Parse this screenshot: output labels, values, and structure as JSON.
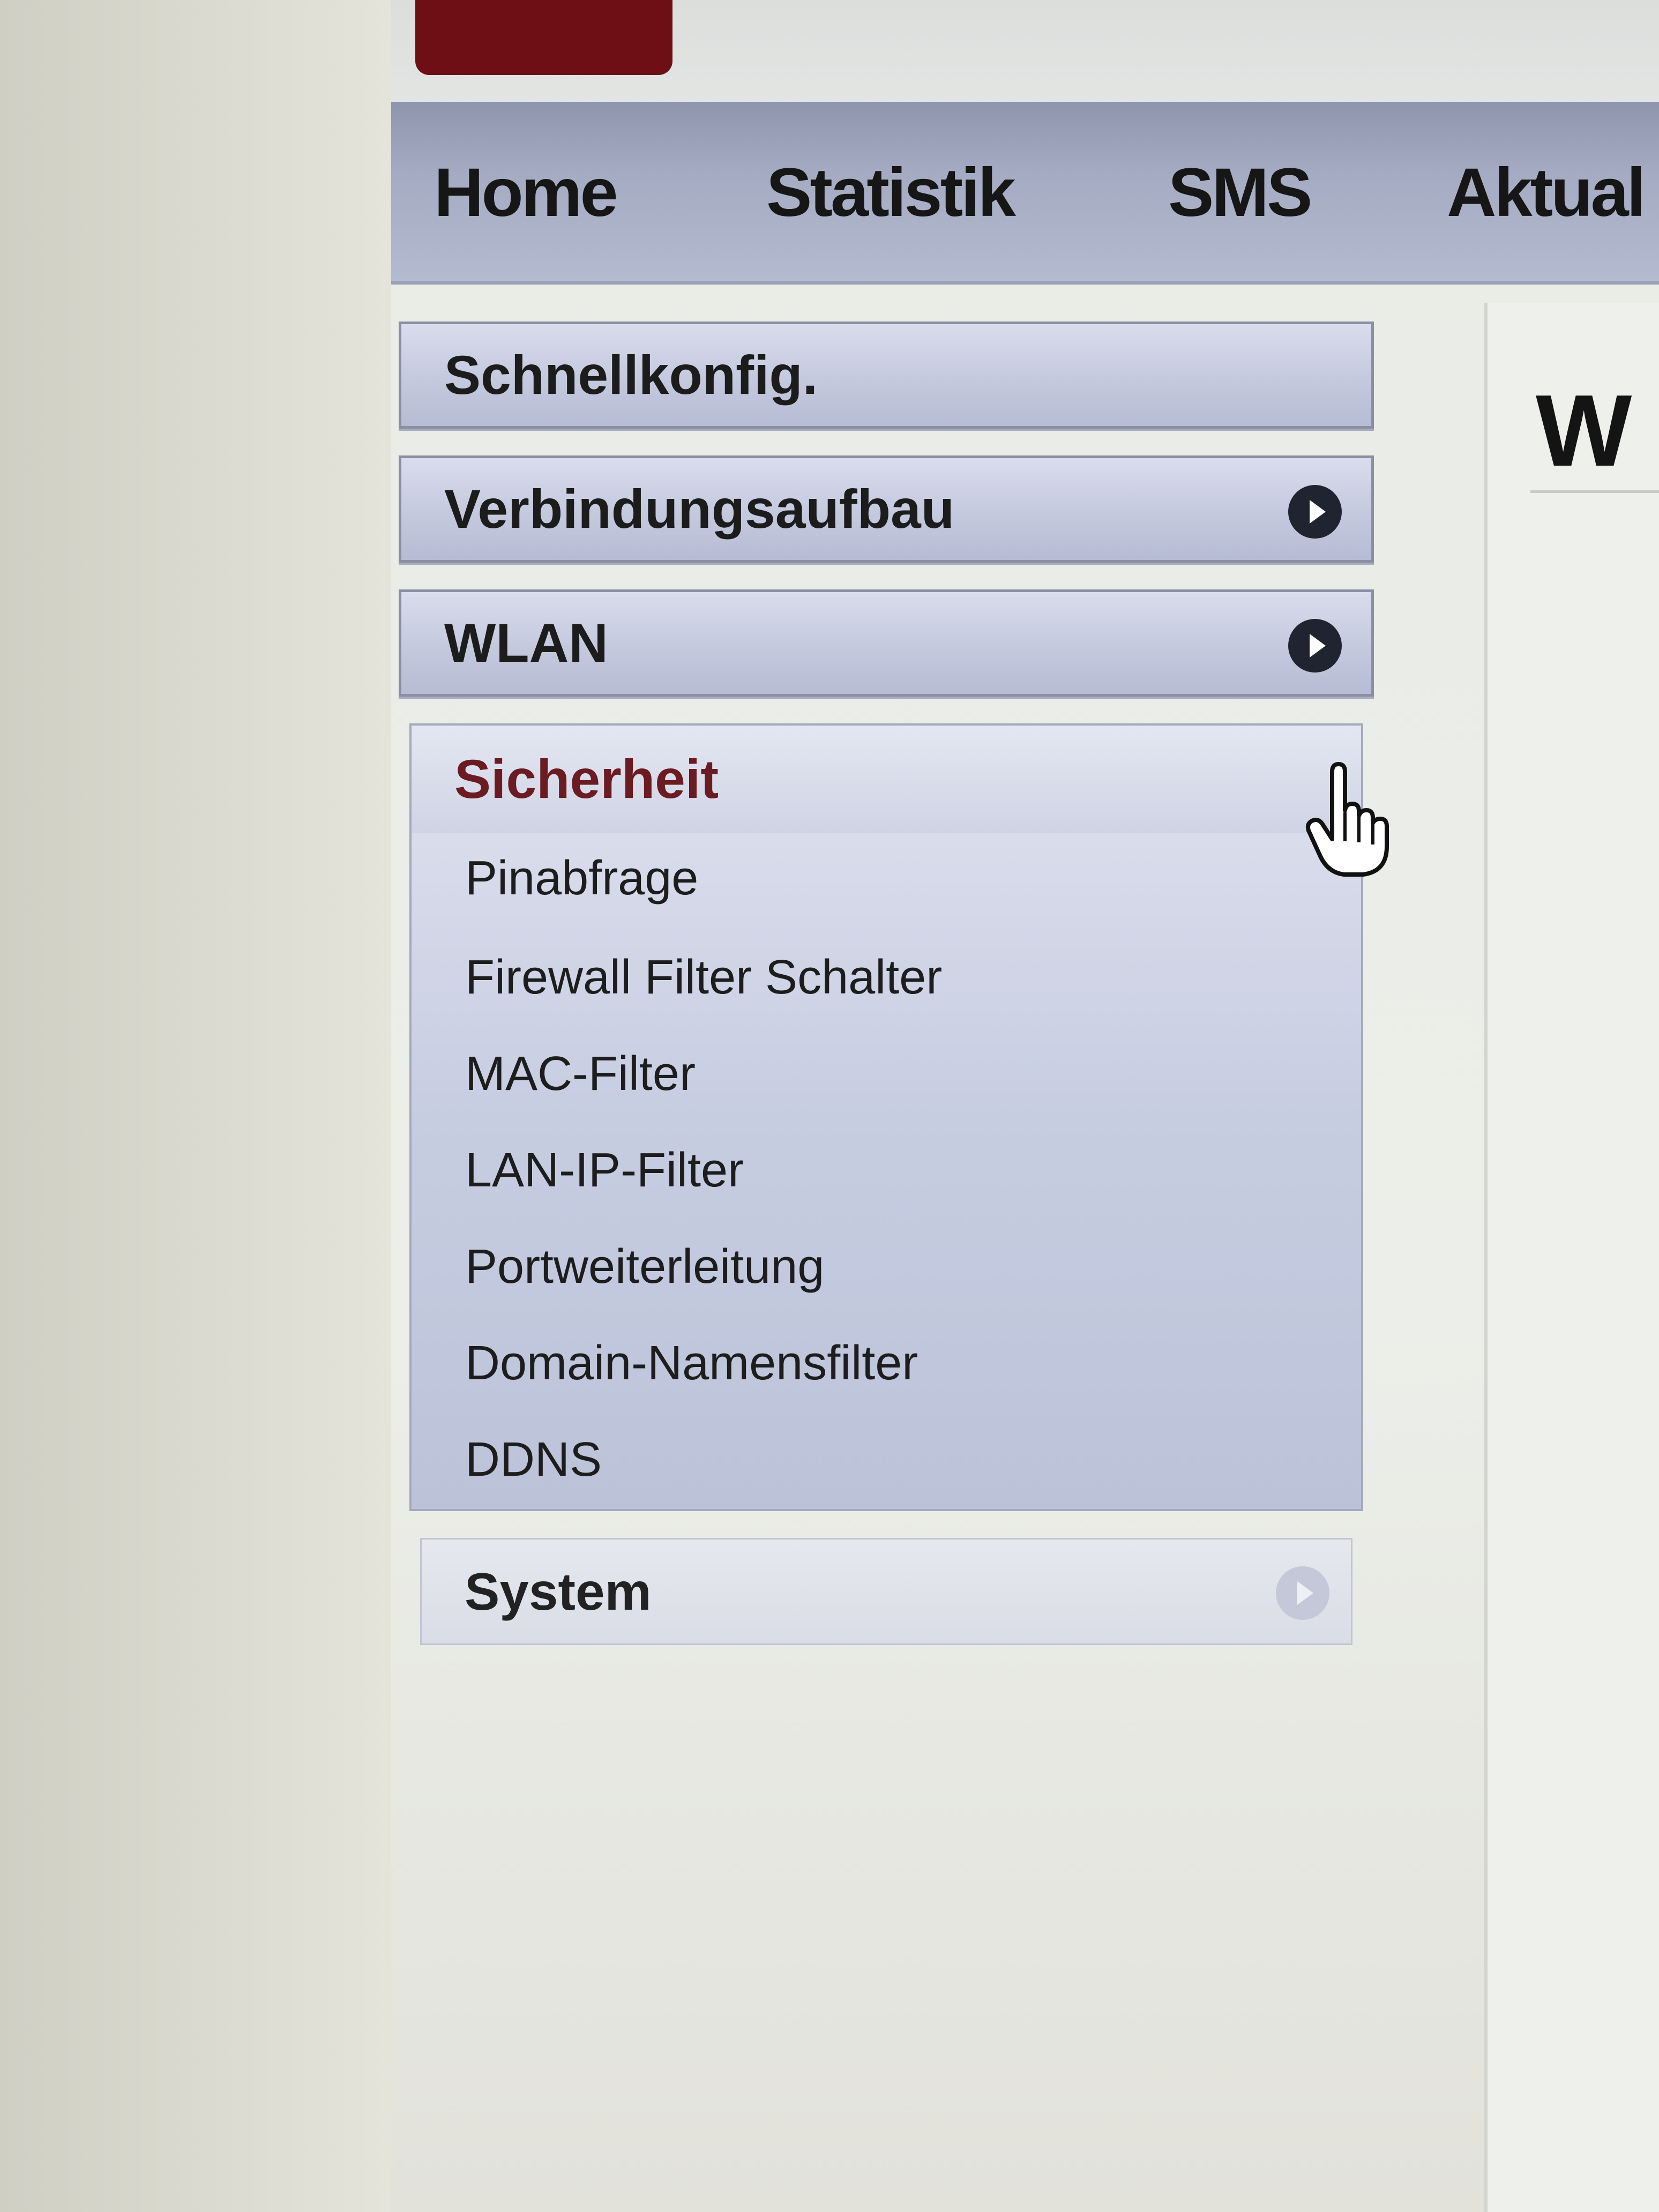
{
  "nav": {
    "items": [
      "Home",
      "Statistik",
      "SMS",
      "Aktual"
    ]
  },
  "content": {
    "title": "W"
  },
  "sidebar": {
    "items": [
      {
        "label": "Schnellkonfig."
      },
      {
        "label": "Verbindungsaufbau",
        "icon": "chevron-right-icon"
      },
      {
        "label": "WLAN",
        "icon": "chevron-right-icon"
      }
    ],
    "open_section": {
      "label": "Sicherheit",
      "icon": "chevron-down-icon",
      "label_color": "#6b1b22",
      "subitems": [
        "Pinabfrage",
        "Firewall Filter Schalter",
        "MAC-Filter",
        "LAN-IP-Filter",
        "Portweiterleitung",
        "Domain-Namensfilter",
        "DDNS"
      ]
    },
    "system": {
      "label": "System",
      "icon": "chevron-right-icon"
    }
  },
  "cursor": {
    "icon": "hand-pointer-icon"
  },
  "colors": {
    "brand": "#6e0f15",
    "nav_bar": "#a4abc2",
    "menu_box": "#c4c9de",
    "chevron": "#1f2430"
  }
}
